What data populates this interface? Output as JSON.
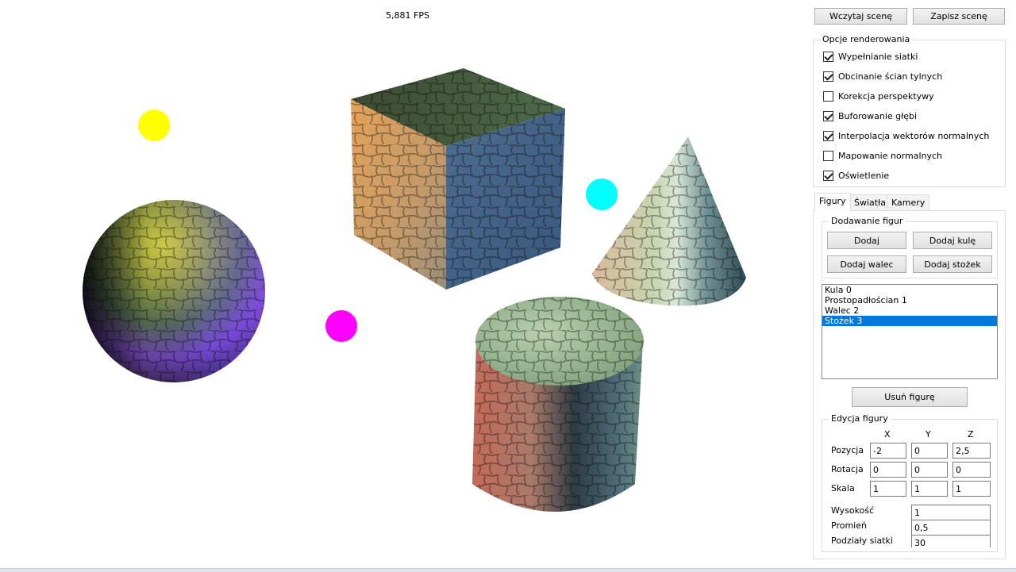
{
  "viewport": {
    "fps": "5,881 FPS",
    "lights": [
      {
        "color": "#ffff00"
      },
      {
        "color": "#00ffff"
      },
      {
        "color": "#ff00ff"
      }
    ],
    "objects": [
      "sphere",
      "box",
      "cone",
      "cylinder"
    ]
  },
  "toolbar": {
    "load_label": "Wczytaj scenę",
    "save_label": "Zapisz scenę"
  },
  "render_options": {
    "title": "Opcje renderowania",
    "items": [
      {
        "label": "Wypełnianie siatki",
        "checked": true
      },
      {
        "label": "Obcinanie ścian tylnych",
        "checked": true
      },
      {
        "label": "Korekcja perspektywy",
        "checked": false
      },
      {
        "label": "Buforowanie głębi",
        "checked": true
      },
      {
        "label": "Interpolacja wektorów normalnych",
        "checked": true
      },
      {
        "label": "Mapowanie normalnych",
        "checked": false
      },
      {
        "label": "Oświetlenie",
        "checked": true
      }
    ]
  },
  "tabs": [
    {
      "label": "Figury",
      "active": true
    },
    {
      "label": "Światła",
      "active": false
    },
    {
      "label": "Kamery",
      "active": false
    }
  ],
  "add_figures": {
    "title": "Dodawanie figur",
    "add_label": "Dodaj",
    "add_sphere_label": "Dodaj kulę",
    "add_cylinder_label": "Dodaj walec",
    "add_cone_label": "Dodaj stożek"
  },
  "figure_list": {
    "items": [
      "Kula 0",
      "Prostopadłościan 1",
      "Walec 2",
      "Stożek 3"
    ],
    "selected_index": 3
  },
  "remove_label": "Usuń figurę",
  "edit_figure": {
    "title": "Edycja figury",
    "axis_x": "X",
    "axis_y": "Y",
    "axis_z": "Z",
    "position_label": "Pozycja",
    "position": [
      "-2",
      "0",
      "2,5"
    ],
    "rotation_label": "Rotacja",
    "rotation": [
      "0",
      "0",
      "0"
    ],
    "scale_label": "Skala",
    "scale": [
      "1",
      "1",
      "1"
    ],
    "height_label": "Wysokość",
    "height": "1",
    "radius_label": "Promień",
    "radius": "0,5",
    "subdivisions_label": "Podziały siatki",
    "subdivisions": "30"
  }
}
